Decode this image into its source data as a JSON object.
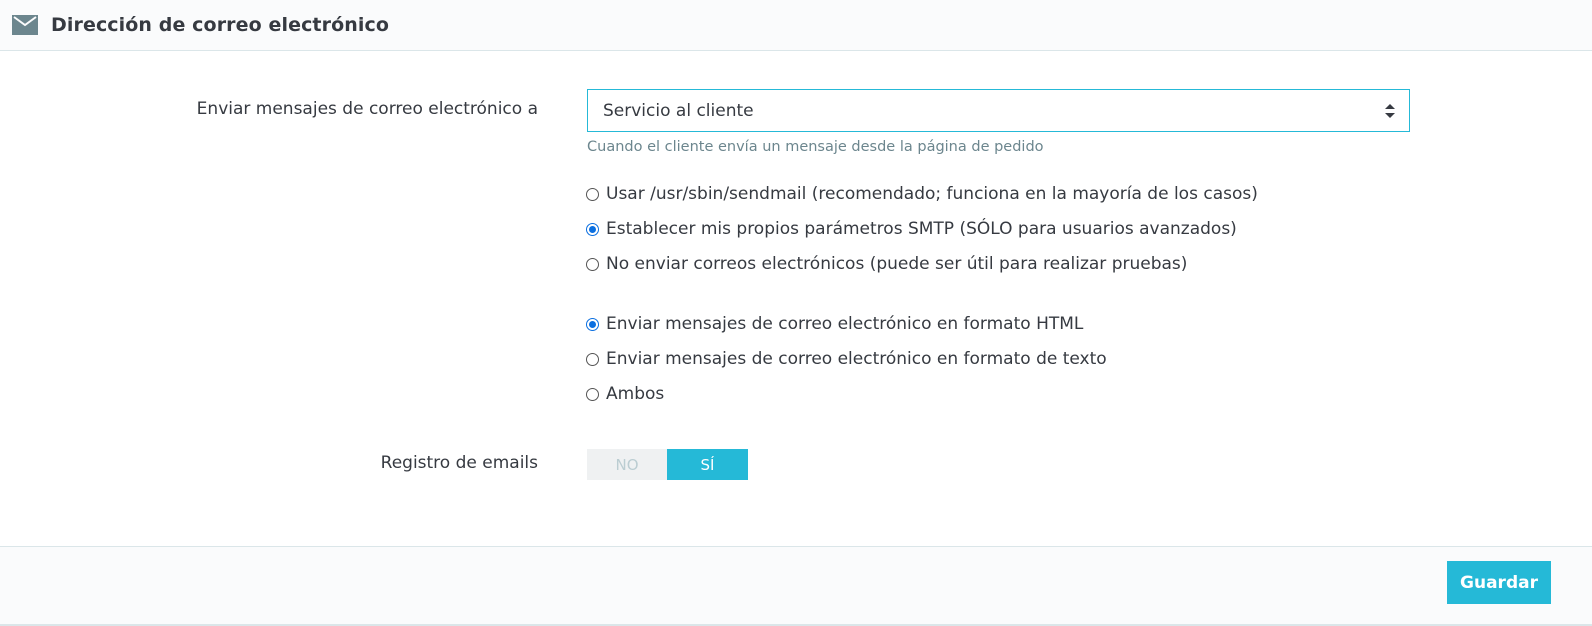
{
  "panel": {
    "title": "Dirección de correo electrónico",
    "icon": "mail-icon"
  },
  "send_to": {
    "label": "Enviar mensajes de correo electrónico a",
    "selected": "Servicio al cliente",
    "help": "Cuando el cliente envía un mensaje desde la página de pedido"
  },
  "mail_method": {
    "options": [
      {
        "label": "Usar /usr/sbin/sendmail (recomendado; funciona en la mayoría de los casos)",
        "checked": false
      },
      {
        "label": "Establecer mis propios parámetros SMTP (SÓLO para usuarios avanzados)",
        "checked": true
      },
      {
        "label": "No enviar correos electrónicos (puede ser útil para realizar pruebas)",
        "checked": false
      }
    ]
  },
  "mail_format": {
    "options": [
      {
        "label": "Enviar mensajes de correo electrónico en formato HTML",
        "checked": true
      },
      {
        "label": "Enviar mensajes de correo electrónico en formato de texto",
        "checked": false
      },
      {
        "label": "Ambos",
        "checked": false
      }
    ]
  },
  "log_emails": {
    "label": "Registro de emails",
    "off_label": "NO",
    "on_label": "SÍ",
    "value": true
  },
  "footer": {
    "save_label": "Guardar"
  },
  "colors": {
    "accent": "#25b9d7",
    "radio_checked": "#0b6fe0",
    "help_text": "#6c868e"
  }
}
